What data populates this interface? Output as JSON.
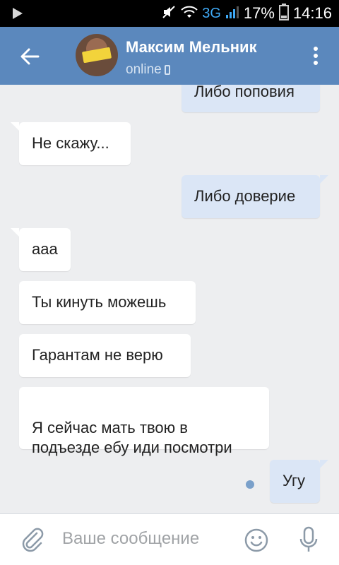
{
  "status_bar": {
    "network": "3G",
    "battery": "17%",
    "time": "14:16"
  },
  "header": {
    "contact_name": "Максим Мельник",
    "status": "online"
  },
  "messages": [
    {
      "direction": "out",
      "text": "Либо поповия"
    },
    {
      "direction": "in",
      "text": "Не скажу..."
    },
    {
      "direction": "out",
      "text": "Либо доверие"
    },
    {
      "direction": "in",
      "text": "ааа"
    },
    {
      "direction": "in",
      "text": "Ты кинуть можешь"
    },
    {
      "direction": "in",
      "text": "Гарантам не верю"
    },
    {
      "direction": "in",
      "text": "Я сейчас мать твою в\nподъезде ебу иди посмотри"
    },
    {
      "direction": "out",
      "text": "Угу"
    }
  ],
  "composer": {
    "placeholder": "Ваше сообщение"
  },
  "colors": {
    "header_bg": "#5b88bd",
    "outgoing_bubble": "#dbe6f6",
    "incoming_bubble": "#ffffff",
    "chat_bg": "#edeef0"
  }
}
